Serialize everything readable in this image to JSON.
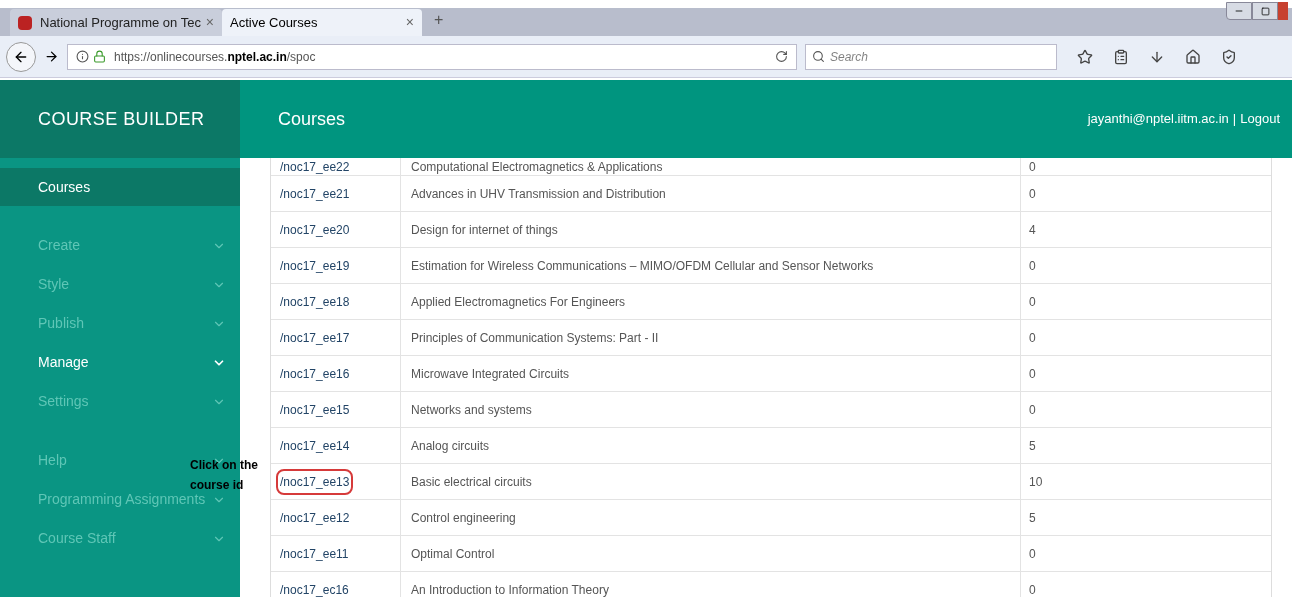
{
  "browser": {
    "tabs": [
      {
        "title": "National Programme on Tec",
        "selected": false,
        "close": "×"
      },
      {
        "title": "Active Courses",
        "selected": true,
        "close": "×"
      }
    ],
    "new_tab": "+",
    "url": {
      "prefix": "https://onlinecourses.",
      "domain": "nptel.ac.in",
      "path": "/spoc"
    },
    "search": {
      "placeholder": "Search"
    }
  },
  "sidebar": {
    "title": "COURSE BUILDER",
    "groups": [
      [
        {
          "label": "Courses",
          "selected": true,
          "enabled": true,
          "kind": "link"
        }
      ],
      [
        {
          "label": "Create",
          "selected": false,
          "enabled": false,
          "kind": "menu"
        },
        {
          "label": "Style",
          "selected": false,
          "enabled": false,
          "kind": "menu"
        },
        {
          "label": "Publish",
          "selected": false,
          "enabled": false,
          "kind": "menu"
        },
        {
          "label": "Manage",
          "selected": false,
          "enabled": true,
          "kind": "menu"
        },
        {
          "label": "Settings",
          "selected": false,
          "enabled": false,
          "kind": "menu"
        }
      ],
      [
        {
          "label": "Help",
          "selected": false,
          "enabled": false,
          "kind": "menu"
        },
        {
          "label": "Programming Assignments",
          "selected": false,
          "enabled": false,
          "kind": "menu"
        },
        {
          "label": "Course Staff",
          "selected": false,
          "enabled": false,
          "kind": "menu"
        }
      ]
    ]
  },
  "header": {
    "title": "Courses",
    "user": "jayanthi@nptel.iitm.ac.in",
    "separator": "|",
    "logout": "Logout"
  },
  "table": {
    "rows": [
      {
        "id": "/noc17_ee22",
        "title": "Computational Electromagnetics & Applications",
        "count": "0",
        "circled": false
      },
      {
        "id": "/noc17_ee21",
        "title": "Advances in UHV Transmission and Distribution",
        "count": "0",
        "circled": false
      },
      {
        "id": "/noc17_ee20",
        "title": "Design for internet of things",
        "count": "4",
        "circled": false
      },
      {
        "id": "/noc17_ee19",
        "title": "Estimation for Wireless Communications – MIMO/OFDM Cellular and Sensor Networks",
        "count": "0",
        "circled": false
      },
      {
        "id": "/noc17_ee18",
        "title": "Applied Electromagnetics For Engineers",
        "count": "0",
        "circled": false
      },
      {
        "id": "/noc17_ee17",
        "title": "Principles of Communication Systems: Part - II",
        "count": "0",
        "circled": false
      },
      {
        "id": "/noc17_ee16",
        "title": "Microwave Integrated Circuits",
        "count": "0",
        "circled": false
      },
      {
        "id": "/noc17_ee15",
        "title": "Networks and systems",
        "count": "0",
        "circled": false
      },
      {
        "id": "/noc17_ee14",
        "title": "Analog circuits",
        "count": "5",
        "circled": false
      },
      {
        "id": "/noc17_ee13",
        "title": "Basic electrical circuits",
        "count": "10",
        "circled": true
      },
      {
        "id": "/noc17_ee12",
        "title": "Control engineering",
        "count": "5",
        "circled": false
      },
      {
        "id": "/noc17_ee11",
        "title": "Optimal Control",
        "count": "0",
        "circled": false
      },
      {
        "id": "/noc17_ec16",
        "title": "An Introduction to Information Theory",
        "count": "0",
        "circled": false
      }
    ]
  },
  "annotation": {
    "lines": [
      "Click on the",
      "course id"
    ]
  }
}
